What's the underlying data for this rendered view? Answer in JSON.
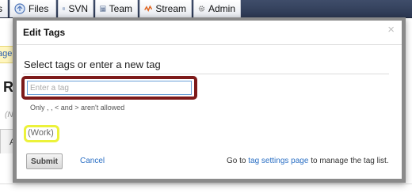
{
  "navbar": {
    "tabs": [
      {
        "label": "s",
        "icon": "partial-tab-icon"
      },
      {
        "label": "Files",
        "icon": "files-icon"
      },
      {
        "label": "SVN",
        "icon": "svn-icon"
      },
      {
        "label": "Team",
        "icon": "team-icon"
      },
      {
        "label": "Stream",
        "icon": "stream-icon"
      },
      {
        "label": "Admin",
        "icon": "gear-icon"
      }
    ]
  },
  "background": {
    "notice_fragment": "age",
    "page_title_fragment": "R",
    "note_fragment": "(N",
    "tab_fragment": "A"
  },
  "dialog": {
    "title": "Edit Tags",
    "close_label": "×",
    "prompt": "Select tags or enter a new tag",
    "input": {
      "value": "",
      "placeholder": "Enter a tag"
    },
    "hint": "Only  ,  ,  <  and  >  aren't allowed",
    "existing_tags": [
      "(Work)"
    ],
    "submit_label": "Submit",
    "cancel_label": "Cancel",
    "footer": {
      "prefix": "Go to ",
      "link": "tag settings page",
      "suffix": " to manage the tag list."
    }
  },
  "colors": {
    "input_highlight": "#7d1a1a",
    "tag_highlight": "#ecf23a",
    "link": "#2a6fc4",
    "navbar": "#2c3852"
  }
}
